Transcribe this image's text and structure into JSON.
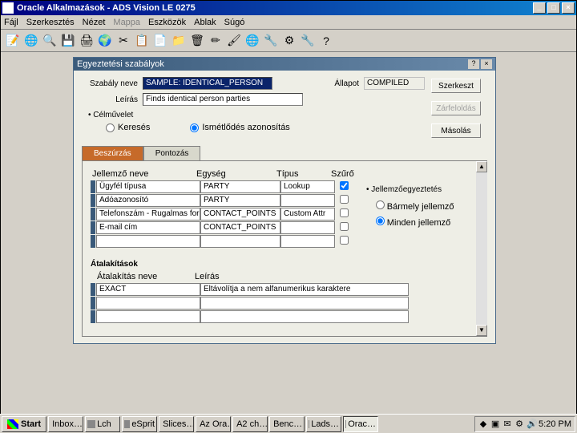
{
  "window": {
    "title": "Oracle Alkalmazások - ADS Vision LE 0275"
  },
  "menubar": {
    "fajl": "Fájl",
    "szerkesztes": "Szerkesztés",
    "nezet": "Nézet",
    "mappa": "Mappa",
    "eszkozok": "Eszközök",
    "ablak": "Ablak",
    "sugo": "Súgó"
  },
  "inner": {
    "title": "Egyeztetési szabályok"
  },
  "form": {
    "szabaly_label": "Szabály neve",
    "szabaly_value": "SAMPLE: IDENTICAL_PERSON",
    "leiras_label": "Leírás",
    "leiras_value": "Finds identical person parties",
    "allapot_label": "Állapot",
    "allapot_value": "COMPILED"
  },
  "buttons": {
    "szerkeszt": "Szerkeszt",
    "zarfeloldas": "Zárfeloldás",
    "masolas": "Másolás"
  },
  "celmuvelet": {
    "header": "• Célművelet",
    "kereses": "Keresés",
    "ismetlodes": "Ismétlődés azonosítás"
  },
  "tabs": {
    "beszurzas": "Beszúrzás",
    "pontozas": "Pontozás"
  },
  "grid": {
    "h_name": "Jellemző neve",
    "h_eg": "Egység",
    "h_type": "Típus",
    "h_sz": "Szűrő",
    "rows": [
      {
        "name": "Ügyfél típusa",
        "eg": "PARTY",
        "type": "Lookup",
        "chk": true
      },
      {
        "name": "Adóazonosító",
        "eg": "PARTY",
        "type": "",
        "chk": false
      },
      {
        "name": "Telefonszám - Rugalmas formá",
        "eg": "CONTACT_POINTS",
        "type": "Custom Attr",
        "chk": false
      },
      {
        "name": "E-mail cím",
        "eg": "CONTACT_POINTS",
        "type": "",
        "chk": false
      },
      {
        "name": "",
        "eg": "",
        "type": "",
        "chk": false
      }
    ]
  },
  "right_panel": {
    "title": "• Jellemzőegyeztetés",
    "r1": "Bármely jellemző",
    "r2": "Minden jellemző"
  },
  "trans": {
    "header": "Átalakítások",
    "col1": "Átalakítás neve",
    "col2": "Leírás",
    "rows": [
      {
        "name": "EXACT",
        "desc": "Eltávolítja a nem alfanumerikus karaktere"
      },
      {
        "name": "",
        "desc": ""
      },
      {
        "name": "",
        "desc": ""
      }
    ]
  },
  "taskbar": {
    "start": "Start",
    "items": [
      "Inbox…",
      "Lch",
      "eSprit",
      "Slices…",
      "Az Ora…",
      "A2 ch…",
      "Benc…",
      "Lads…",
      "Orac…"
    ],
    "time": "5:20 PM"
  },
  "icons": {
    "search": "🔍",
    "globe": "🌐",
    "save": "💾",
    "print": "🖨",
    "scissors": "✂",
    "copy": "📋",
    "paste": "📄",
    "folder": "📁",
    "trash": "🗑",
    "pencil": "✏",
    "brush": "🖌",
    "world": "🌍",
    "wrench": "🔧",
    "gear": "⚙",
    "help": "?",
    "doc": "📝"
  }
}
